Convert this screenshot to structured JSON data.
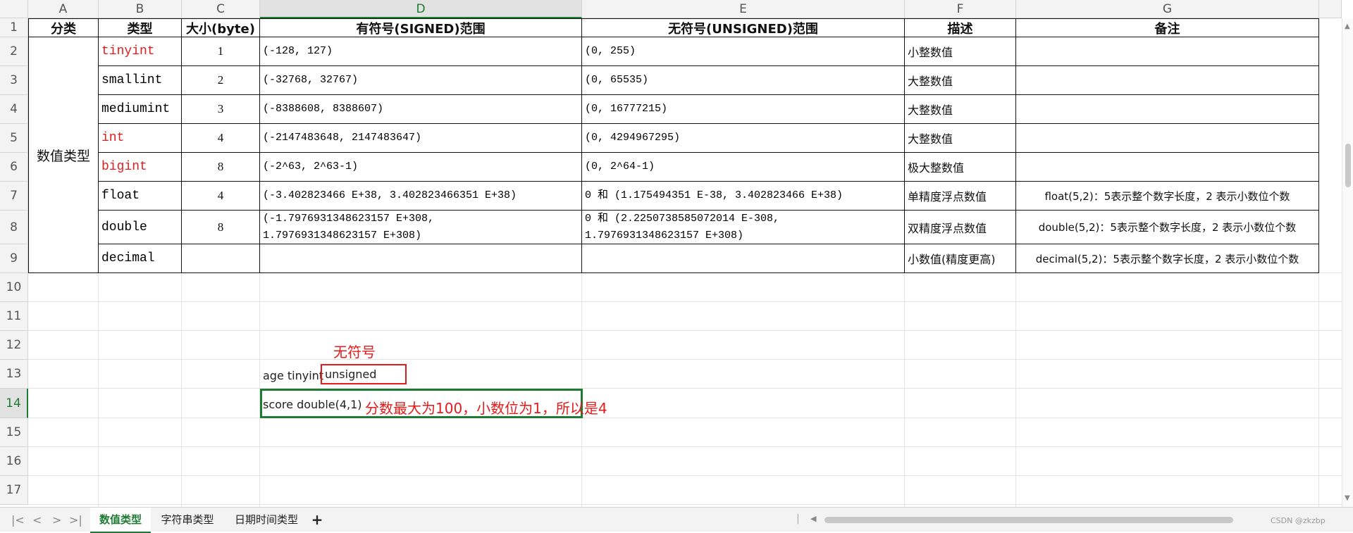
{
  "columns": [
    "A",
    "B",
    "C",
    "D",
    "E",
    "F",
    "G"
  ],
  "rows": [
    "1",
    "2",
    "3",
    "4",
    "5",
    "6",
    "7",
    "8",
    "9",
    "10",
    "11",
    "12",
    "13",
    "14",
    "15",
    "16",
    "17"
  ],
  "header": {
    "category": "分类",
    "type": "类型",
    "size": "大小(byte)",
    "signed": "有符号(SIGNED)范围",
    "unsigned": "无符号(UNSIGNED)范围",
    "desc": "描述",
    "note": "备注"
  },
  "category_label": "数值类型",
  "table": [
    {
      "type": "tinyint",
      "red": true,
      "size": "1",
      "signed": "(-128, 127)",
      "unsigned": "(0, 255)",
      "desc": "小整数值",
      "note": ""
    },
    {
      "type": "smallint",
      "red": false,
      "size": "2",
      "signed": "(-32768, 32767)",
      "unsigned": "(0, 65535)",
      "desc": "大整数值",
      "note": ""
    },
    {
      "type": "mediumint",
      "red": false,
      "size": "3",
      "signed": "(-8388608, 8388607)",
      "unsigned": "(0, 16777215)",
      "desc": "大整数值",
      "note": ""
    },
    {
      "type": "int",
      "red": true,
      "size": "4",
      "signed": "(-2147483648, 2147483647)",
      "unsigned": "(0, 4294967295)",
      "desc": "大整数值",
      "note": ""
    },
    {
      "type": "bigint",
      "red": true,
      "size": "8",
      "signed": "(-2^63, 2^63-1)",
      "unsigned": "(0, 2^64-1)",
      "desc": "极大整数值",
      "note": ""
    },
    {
      "type": "float",
      "red": false,
      "size": "4",
      "signed": "(-3.402823466 E+38, 3.402823466351 E+38)",
      "unsigned": "0 和 (1.175494351 E-38, 3.402823466 E+38)",
      "desc": "单精度浮点数值",
      "note": "float(5,2)：5表示整个数字长度，2 表示小数位个数"
    },
    {
      "type": "double",
      "red": false,
      "size": "8",
      "signed": "(-1.7976931348623157 E+308,\n1.7976931348623157 E+308)",
      "unsigned": "0 和 (2.2250738585072014 E-308,\n1.7976931348623157 E+308)",
      "desc": "双精度浮点数值",
      "note": "double(5,2)：5表示整个数字长度，2 表示小数位个数"
    },
    {
      "type": "decimal",
      "red": false,
      "size": "",
      "signed": "",
      "unsigned": "",
      "desc": "小数值(精度更高)",
      "note": "decimal(5,2)：5表示整个数字长度，2 表示小数位个数"
    }
  ],
  "annotations": {
    "unsigned_label": "无符号",
    "age_prefix": "age tinyint",
    "age_unsigned": "unsigned",
    "score_text": "score double(4,1)",
    "score_note": "分数最大为100，小数位为1，所以是4"
  },
  "tabs": [
    "数值类型",
    "字符串类型",
    "日期时间类型"
  ],
  "add_tab": "+",
  "watermark": "CSDN @zkzbp",
  "colors": {
    "accent": "#1e7b34",
    "red": "#e31b1b"
  }
}
